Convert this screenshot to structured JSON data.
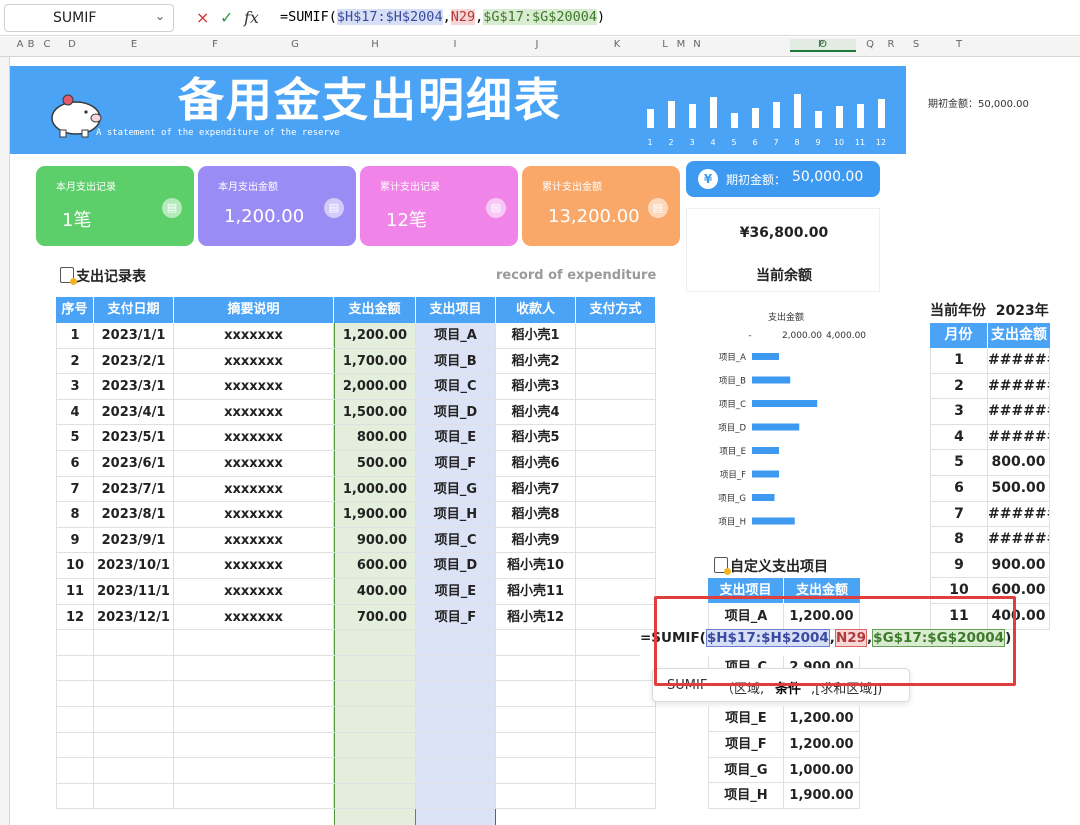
{
  "formula_bar": {
    "name_box": "SUMIF",
    "formula_prefix": "=SUMIF(",
    "ref1": "$H$17:$H$2004",
    "sep": ",",
    "ref2": "N29",
    "ref3": "$G$17:$G$20004",
    "suffix": ")",
    "cancel_icon": "×",
    "confirm_icon": "✓",
    "fx_label": "fx"
  },
  "columns": [
    "A",
    "B",
    "C",
    "D",
    "E",
    "F",
    "G",
    "H",
    "I",
    "J",
    "K",
    "L",
    "M",
    "N",
    "O",
    "P",
    "Q",
    "R",
    "S",
    "T"
  ],
  "banner": {
    "title": "备用金支出明细表",
    "subtitle": "A statement of the expenditure of the reserve",
    "months": [
      "1",
      "2",
      "3",
      "4",
      "5",
      "6",
      "7",
      "8",
      "9",
      "10",
      "11",
      "12"
    ],
    "month_bar_levels": [
      0.55,
      0.8,
      0.7,
      0.9,
      0.45,
      0.6,
      0.75,
      1.0,
      0.5,
      0.65,
      0.7,
      0.85
    ]
  },
  "initial_amount_top": "期初金额：50,000.00",
  "cards": [
    {
      "title": "本月支出记录",
      "value": "1笔",
      "color": "#5ccf6a"
    },
    {
      "title": "本月支出金额",
      "value": "1,200.00",
      "color": "#9b8cf5"
    },
    {
      "title": "累计支出记录",
      "value": "12笔",
      "color": "#f184e8"
    },
    {
      "title": "累计支出金额",
      "value": "13,200.00",
      "color": "#f9a86a"
    }
  ],
  "initial_button": {
    "yen": "¥",
    "label": "期初金额：",
    "value": "50,000.00"
  },
  "balance": {
    "value": "¥36,800.00",
    "label": "当前余额"
  },
  "main_table": {
    "title": "支出记录表",
    "title_en": "record of expenditure",
    "headers": [
      "序号",
      "支付日期",
      "摘要说明",
      "支出金额",
      "支出项目",
      "收款人",
      "支付方式"
    ],
    "rows": [
      [
        "1",
        "2023/1/1",
        "xxxxxxx",
        "1,200.00",
        "项目_A",
        "稻小壳1",
        ""
      ],
      [
        "2",
        "2023/2/1",
        "xxxxxxx",
        "1,700.00",
        "项目_B",
        "稻小壳2",
        ""
      ],
      [
        "3",
        "2023/3/1",
        "xxxxxxx",
        "2,000.00",
        "项目_C",
        "稻小壳3",
        ""
      ],
      [
        "4",
        "2023/4/1",
        "xxxxxxx",
        "1,500.00",
        "项目_D",
        "稻小壳4",
        ""
      ],
      [
        "5",
        "2023/5/1",
        "xxxxxxx",
        "800.00",
        "项目_E",
        "稻小壳5",
        ""
      ],
      [
        "6",
        "2023/6/1",
        "xxxxxxx",
        "500.00",
        "项目_F",
        "稻小壳6",
        ""
      ],
      [
        "7",
        "2023/7/1",
        "xxxxxxx",
        "1,000.00",
        "项目_G",
        "稻小壳7",
        ""
      ],
      [
        "8",
        "2023/8/1",
        "xxxxxxx",
        "1,900.00",
        "项目_H",
        "稻小壳8",
        ""
      ],
      [
        "9",
        "2023/9/1",
        "xxxxxxx",
        "900.00",
        "项目_C",
        "稻小壳9",
        ""
      ],
      [
        "10",
        "2023/10/1",
        "xxxxxxx",
        "600.00",
        "项目_D",
        "稻小壳10",
        ""
      ],
      [
        "11",
        "2023/11/1",
        "xxxxxxx",
        "400.00",
        "项目_E",
        "稻小壳11",
        ""
      ],
      [
        "12",
        "2023/12/1",
        "xxxxxxx",
        "700.00",
        "项目_F",
        "稻小壳12",
        ""
      ]
    ]
  },
  "chart_data": {
    "type": "bar",
    "orientation": "horizontal",
    "title": "支出金额",
    "axis_ticks": [
      "-",
      "2,000.00",
      "4,000.00"
    ],
    "xlim": [
      0,
      4000
    ],
    "categories": [
      "项目_A",
      "项目_B",
      "项目_C",
      "项目_D",
      "项目_E",
      "项目_F",
      "项目_G",
      "项目_H"
    ],
    "values": [
      1200,
      1700,
      2900,
      2100,
      1200,
      1200,
      1000,
      1900
    ],
    "color": "#3d9af0"
  },
  "custom_table": {
    "title": "自定义支出项目",
    "headers": [
      "支出项目",
      "支出金额"
    ],
    "rows": [
      [
        "项目_A",
        "1,200.00"
      ],
      [
        "项目_C",
        "2,900.00"
      ],
      [
        "项目_E",
        "1,200.00"
      ],
      [
        "项目_F",
        "1,200.00"
      ],
      [
        "项目_G",
        "1,000.00"
      ],
      [
        "项目_H",
        "1,900.00"
      ]
    ]
  },
  "year_table": {
    "label": "当前年份",
    "year": "2023年",
    "headers": [
      "月份",
      "支出金额"
    ],
    "rows": [
      [
        "1",
        "######"
      ],
      [
        "2",
        "######"
      ],
      [
        "3",
        "######"
      ],
      [
        "4",
        "######"
      ],
      [
        "5",
        "800.00"
      ],
      [
        "6",
        "500.00"
      ],
      [
        "7",
        "######"
      ],
      [
        "8",
        "######"
      ],
      [
        "9",
        "900.00"
      ],
      [
        "10",
        "600.00"
      ],
      [
        "11",
        "400.00"
      ]
    ]
  },
  "edit_cell": {
    "prefix": "=SUMIF(",
    "ref1": "$H$17:$H$2004",
    "ref2": "N29",
    "ref3": "$G$17:$G$20004",
    "sep": ",",
    "suffix": ")"
  },
  "tooltip": {
    "fn": "SUMIF",
    "open": "（区域,",
    "arg_bold": "条件",
    "rest": ",[求和区域])"
  }
}
